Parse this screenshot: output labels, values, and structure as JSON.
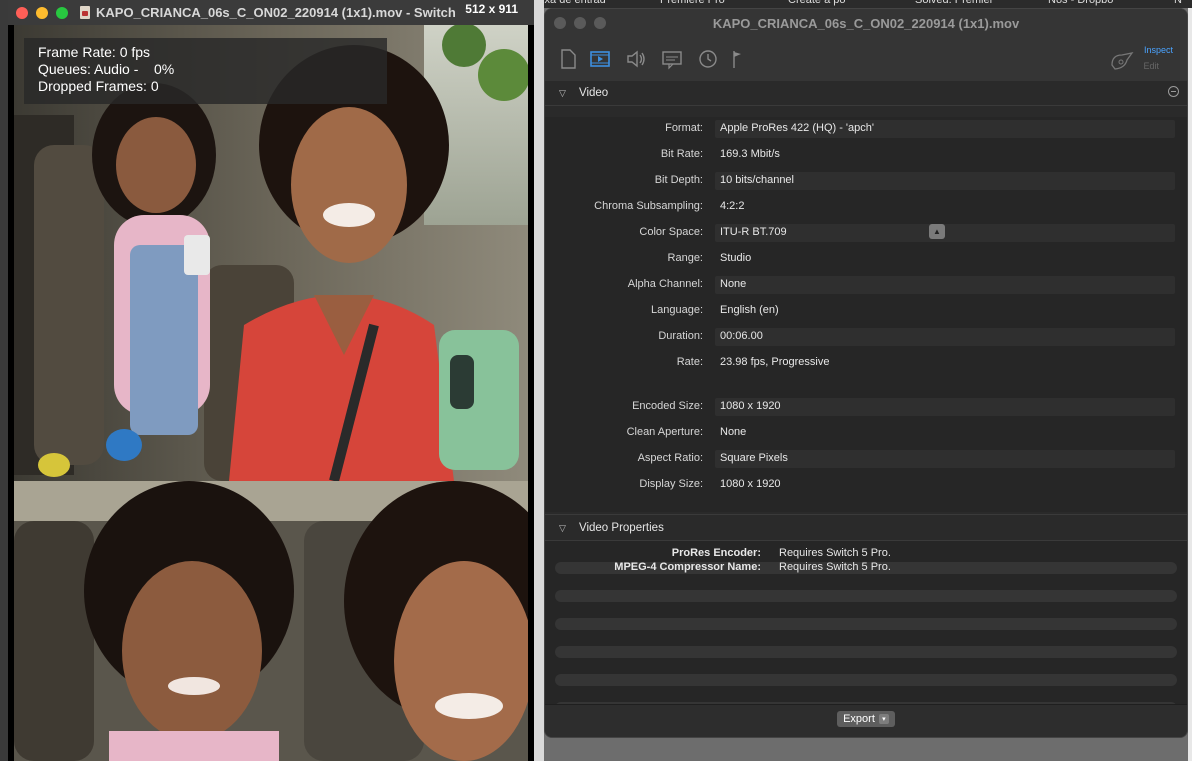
{
  "background_tabs": [
    {
      "label": "aixa de entrad"
    },
    {
      "label": "Premiere Pro"
    },
    {
      "label": "Create a po"
    },
    {
      "label": "Solved: Premier"
    },
    {
      "label": "Nos - Dropbo"
    },
    {
      "label": "N"
    }
  ],
  "player": {
    "title": "KAPO_CRIANCA_06s_C_ON02_220914 (1x1).mov - Switch",
    "dimensions": "512 x 911",
    "stats": {
      "frame_rate": "Frame Rate: 0 fps",
      "queues": "Queues: Audio -    0%",
      "dropped": "Dropped Frames: 0"
    }
  },
  "inspector": {
    "title": "KAPO_CRIANCA_06s_C_ON02_220914 (1x1).mov",
    "toolbar": {
      "icons": [
        "document-icon",
        "video-icon",
        "audio-icon",
        "subtitle-icon",
        "clock-icon",
        "flag-icon"
      ],
      "mode_inspect": "Inspect",
      "mode_edit": "Edit"
    },
    "video_section": {
      "title": "Video",
      "properties": [
        {
          "label": "Format:",
          "value": "Apple ProRes 422 (HQ) - 'apch'"
        },
        {
          "label": "Bit Rate:",
          "value": "169.3 Mbit/s"
        },
        {
          "label": "Bit Depth:",
          "value": "10 bits/channel"
        },
        {
          "label": "Chroma Subsampling:",
          "value": "4:2:2"
        },
        {
          "label": "Color Space:",
          "value": "ITU-R BT.709"
        },
        {
          "label": "Range:",
          "value": "Studio"
        },
        {
          "label": "Alpha Channel:",
          "value": "None"
        },
        {
          "label": "Language:",
          "value": "English (en)"
        },
        {
          "label": "Duration:",
          "value": "00:06.00"
        },
        {
          "label": "Rate:",
          "value": "23.98 fps, Progressive"
        },
        {
          "label": "Encoded Size:",
          "value": "1080 x 1920"
        },
        {
          "label": "Clean Aperture:",
          "value": "None"
        },
        {
          "label": "Aspect Ratio:",
          "value": "Square Pixels"
        },
        {
          "label": "Display Size:",
          "value": "1080 x 1920"
        }
      ]
    },
    "video_properties_section": {
      "title": "Video Properties",
      "rows": [
        {
          "label": "ProRes Encoder:",
          "value": "Requires Switch 5 Pro."
        },
        {
          "label": "MPEG-4 Compressor Name:",
          "value": "Requires Switch 5 Pro."
        }
      ]
    },
    "export_label": "Export"
  }
}
